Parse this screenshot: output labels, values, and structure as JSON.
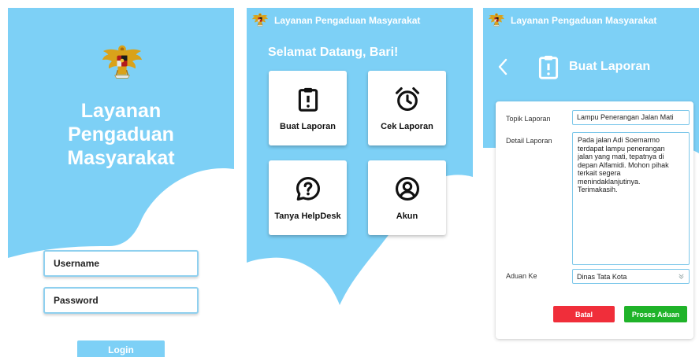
{
  "colors": {
    "sky": "#7dd0f6",
    "field_border": "#8fd0ef",
    "danger": "#f02e3a",
    "success": "#1fb329"
  },
  "login_screen": {
    "title_lines": [
      "Layanan",
      "Pengaduan",
      "Masyarakat"
    ],
    "username_placeholder": "Username",
    "password_placeholder": "Password",
    "login_label": "Login",
    "logo_icon": "garuda-emblem-icon"
  },
  "menu_screen": {
    "header_title": "Layanan Pengaduan Masyarakat",
    "welcome": "Selamat Datang, Bari!",
    "tiles": [
      {
        "label": "Buat Laporan",
        "icon": "clipboard-alert-icon"
      },
      {
        "label": "Cek Laporan",
        "icon": "alarm-clock-icon"
      },
      {
        "label": "Tanya HelpDesk",
        "icon": "question-bubble-icon"
      },
      {
        "label": "Akun",
        "icon": "user-circle-icon"
      }
    ]
  },
  "form_screen": {
    "header_title": "Layanan Pengaduan Masyarakat",
    "page_title": "Buat Laporan",
    "topik_label": "Topik Laporan",
    "topik_value": "Lampu Penerangan Jalan Mati",
    "detail_label": "Detail Laporan",
    "detail_value": "Pada jalan Adi Soemarmo\nterdapat lampu penerangan\njalan yang mati, tepatnya di\ndepan Alfamidi. Mohon pihak\nterkait segera\nmenindaklanjutinya.\nTerimakasih.",
    "aduan_label": "Aduan Ke",
    "aduan_value": "Dinas Tata Kota",
    "cancel_label": "Batal",
    "submit_label": "Proses Aduan"
  }
}
